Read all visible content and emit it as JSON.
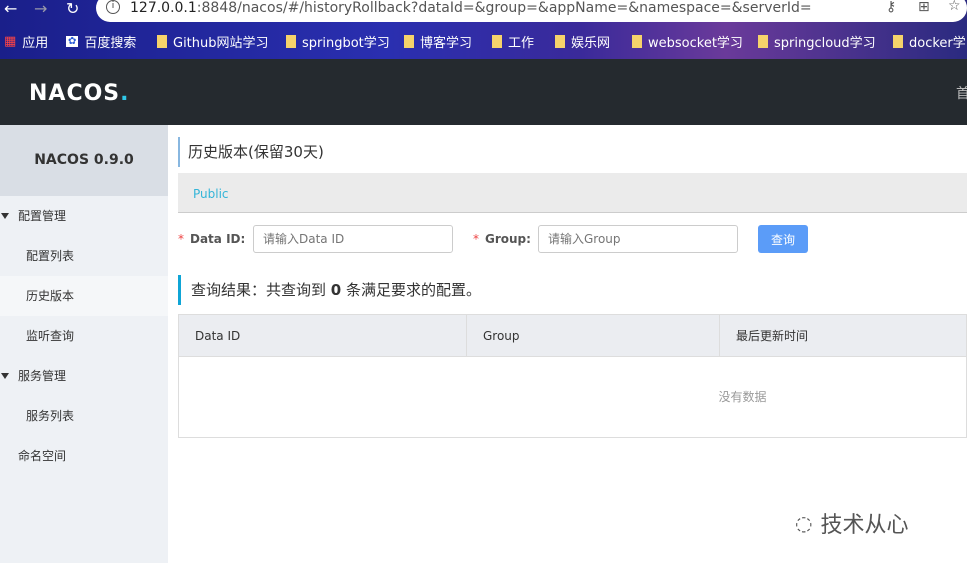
{
  "browser": {
    "url_host": "127.0.0.1",
    "url_rest": ":8848/nacos/#/historyRollback?dataId=&group=&appName=&namespace=&serverId=",
    "bookmarks": [
      "应用",
      "百度搜索",
      "Github网站学习",
      "springbot学习",
      "博客学习",
      "工作",
      "娱乐网",
      "websocket学习",
      "springcloud学习",
      "docker学习"
    ]
  },
  "header": {
    "logo": "NACOS",
    "logo_dot": ".",
    "nav_home": "首"
  },
  "sidebar": {
    "version": "NACOS 0.9.0",
    "items": [
      {
        "label": "配置管理"
      },
      {
        "label": "配置列表"
      },
      {
        "label": "历史版本"
      },
      {
        "label": "监听查询"
      },
      {
        "label": "服务管理"
      },
      {
        "label": "服务列表"
      },
      {
        "label": "命名空间"
      }
    ]
  },
  "main": {
    "title": "历史版本(保留30天)",
    "namespace": "Public",
    "form": {
      "data_id_label": "Data ID:",
      "data_id_placeholder": "请输入Data ID",
      "group_label": "Group:",
      "group_placeholder": "请输入Group",
      "required": "*",
      "query": "查询"
    },
    "result_prefix": "查询结果：共查询到 ",
    "result_count": "0",
    "result_suffix": " 条满足要求的配置。",
    "table": {
      "columns": [
        "Data ID",
        "Group",
        "最后更新时间"
      ],
      "empty": "没有数据"
    }
  },
  "watermark": "技术从心"
}
